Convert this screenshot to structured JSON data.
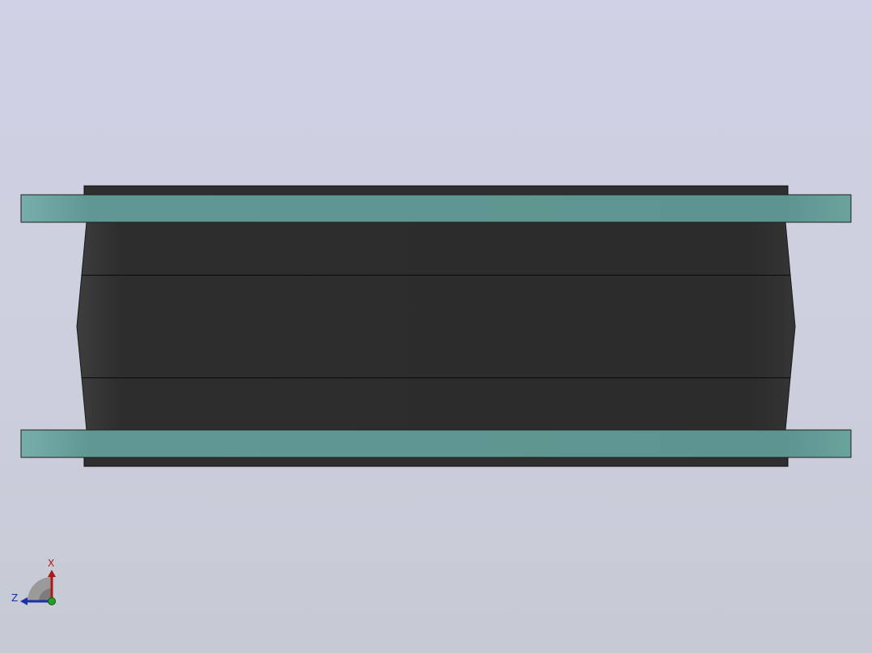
{
  "viewport": {
    "background_top": "#d0d0e6",
    "background_bottom": "#c6cad4"
  },
  "model": {
    "body_color": "#2c2c2c",
    "flange_color": "#5e9690",
    "edge_color": "#101010"
  },
  "triad": {
    "x_label": "X",
    "z_label": "Z",
    "x_color": "#b01818",
    "z_color": "#1c2fa8",
    "y_color": "#22a022"
  }
}
